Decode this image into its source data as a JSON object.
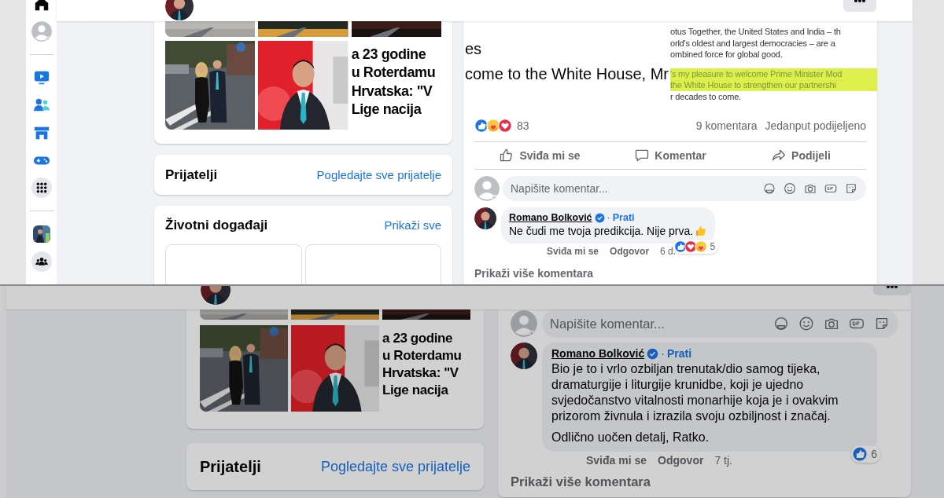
{
  "top_view": {
    "photos_card": {
      "tiles": [
        {
          "kind": "picture"
        },
        {
          "kind": "picture"
        },
        {
          "kind": "text",
          "lines": [
            "a 23 godine",
            "u Roterdamu",
            "Hrvatska: \"V",
            "Lige nacija"
          ]
        }
      ]
    },
    "friends_card": {
      "title": "Prijatelji",
      "link": "Pogledajte sve prijatelje"
    },
    "life_events_card": {
      "title": "Životni događaji",
      "link": "Prikaži sve"
    },
    "post": {
      "image": {
        "left_lines": [
          "es",
          "come to the White House, Mr"
        ],
        "right_lines": [
          {
            "text": "otus Together, the United States and India – th",
            "highlighted": false
          },
          {
            "text": "orld's oldest and largest democracies – are a",
            "highlighted": false
          },
          {
            "text": "ombined force for global good.",
            "highlighted": false
          },
          {
            "text": "'s my pleasure to welcome Prime Minister Mod",
            "highlighted": true
          },
          {
            "text": "the White House to strengthen our partnershi",
            "highlighted": true
          },
          {
            "text": "r decades to come.",
            "highlighted": false
          }
        ]
      },
      "reactions": [
        {
          "kind": "like"
        },
        {
          "kind": "care"
        },
        {
          "kind": "love"
        }
      ],
      "reaction_count": "83",
      "comment_count": "9 komentara",
      "share_count": "Jedanput podijeljeno",
      "actions": [
        {
          "kind": "like",
          "label": "Sviđa mi se"
        },
        {
          "kind": "comment",
          "label": "Komentar"
        },
        {
          "kind": "share",
          "label": "Podijeli"
        }
      ],
      "comment_field": {
        "placeholder": "Napišite komentar..."
      },
      "comments": [
        {
          "author": "Romano Bolković",
          "verified": true,
          "separator": "·",
          "follow": "Prati",
          "paragraphs": [
            "Ne čudi me tvoja predikcija. Nije prva."
          ],
          "thumbs_up_emoji": true,
          "like": "Sviđa mi se",
          "reply": "Odgovor",
          "time": "6 d.",
          "reactions": [
            {
              "kind": "like"
            },
            {
              "kind": "love"
            },
            {
              "kind": "care"
            }
          ],
          "reaction_count": "5"
        }
      ],
      "more_comments": "Prikaži više komentara"
    }
  },
  "bottom_view": {
    "photos_card": {
      "tiles": [
        {
          "kind": "picture"
        },
        {
          "kind": "picture"
        },
        {
          "kind": "text",
          "lines": [
            "a 23 godine",
            "u Roterdamu",
            "Hrvatska: \"V",
            "Lige nacija"
          ]
        }
      ]
    },
    "friends_card": {
      "title": "Prijatelji",
      "link": "Pogledajte sve prijatelje"
    },
    "post": {
      "comment_field": {
        "placeholder": "Napišite komentar..."
      },
      "comments": [
        {
          "author": "Romano Bolković",
          "verified": true,
          "separator": "·",
          "follow": "Prati",
          "paragraphs": [
            "Bio je to i vrlo ozbiljan trenutak/dio samog tijeka, dramaturgije i liturgije krunidbe, koji je ujedno svjedočanstvo vitalnosti monarhije koja je i ovakvim prizorom živnula i izrazila svoju ozbiljnost i značaj.",
            "Odlično uočen detalj, Ratko."
          ],
          "like": "Sviđa mi se",
          "reply": "Odgovor",
          "time": "7 tj.",
          "reactions": [
            {
              "kind": "like"
            }
          ],
          "reaction_count": "6"
        }
      ],
      "more_comments": "Prikaži više komentara"
    }
  }
}
